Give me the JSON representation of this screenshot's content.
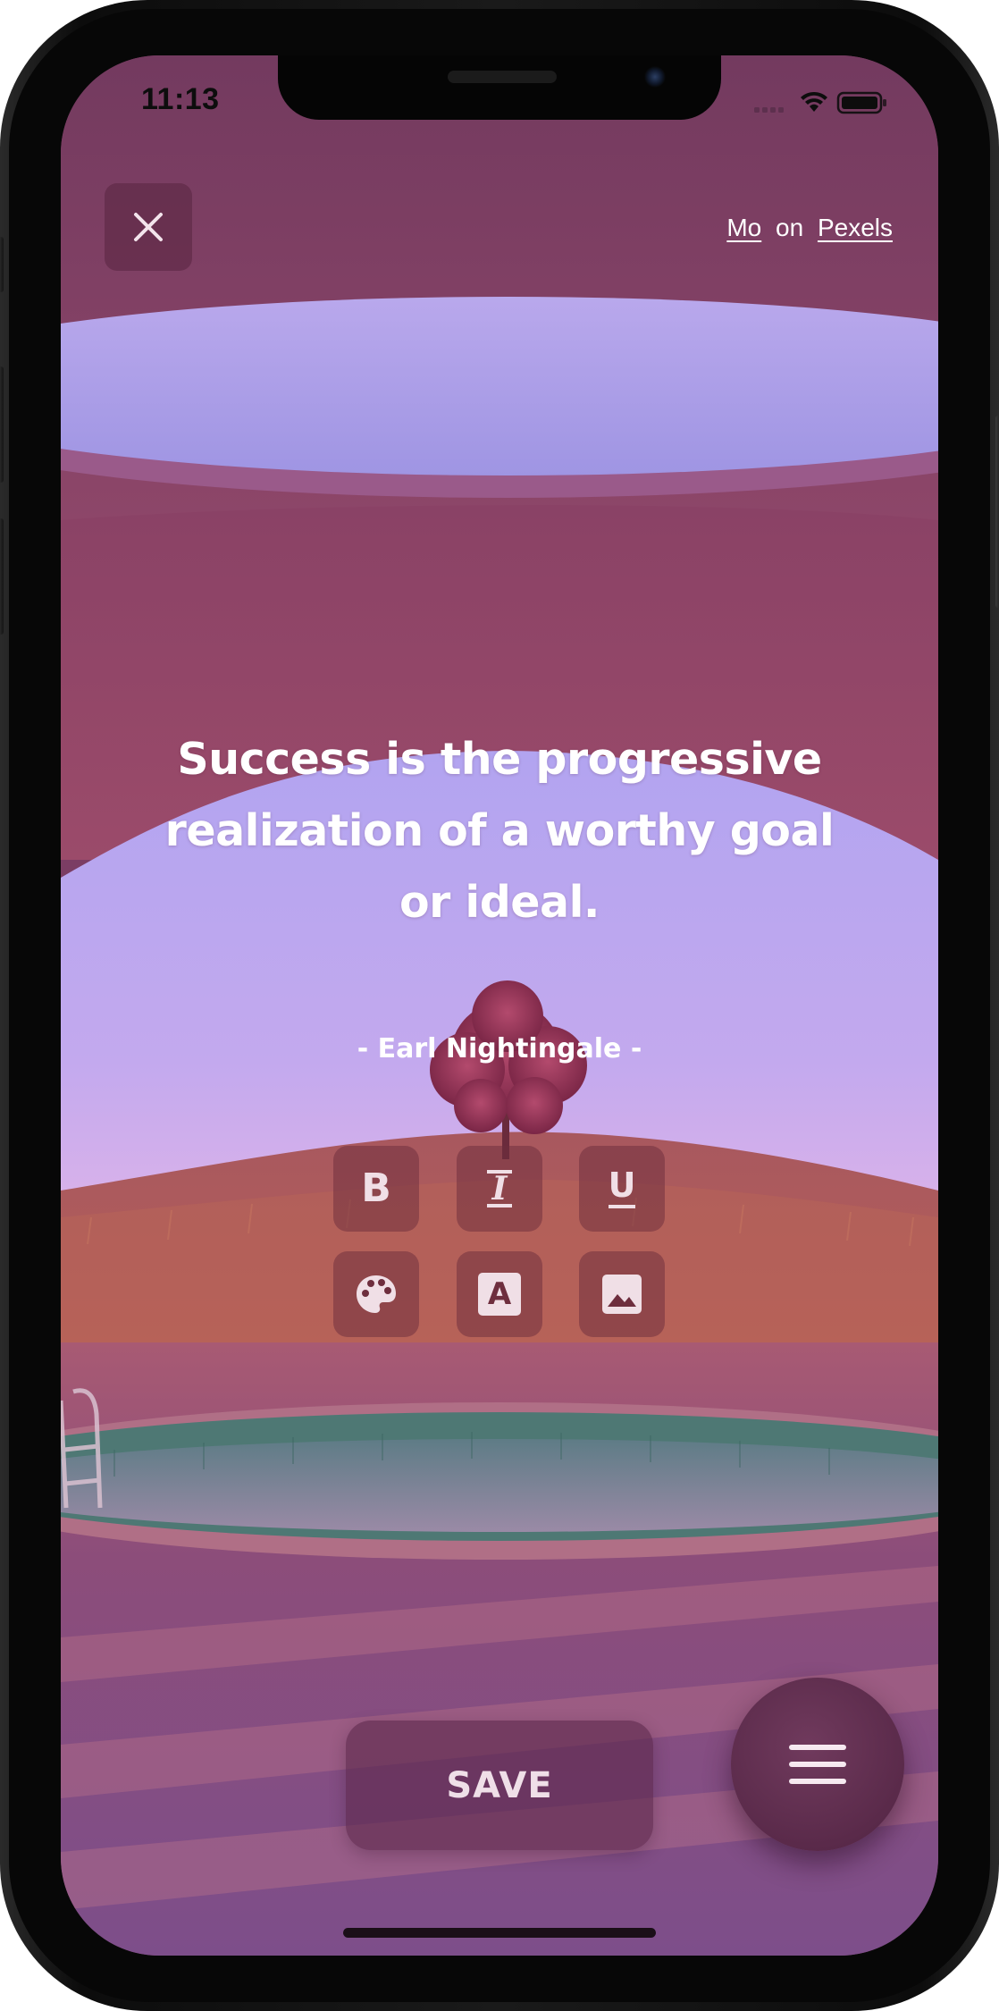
{
  "status_bar": {
    "time": "11:13"
  },
  "header": {
    "close_icon": "close-icon",
    "credit": {
      "author": "Mo",
      "separator": "on",
      "source": "Pexels"
    }
  },
  "quote": {
    "text": "Success is the progressive realization of a worthy goal or ideal.",
    "author": "- Earl Nightingale -"
  },
  "formatting": {
    "bold_label": "B",
    "italic_label": "I",
    "underline_label": "U",
    "font_label": "A",
    "icons": [
      "bold-icon",
      "italic-icon",
      "underline-icon",
      "palette-icon",
      "font-icon",
      "image-icon"
    ]
  },
  "actions": {
    "save_label": "SAVE",
    "menu_icon": "menu-icon"
  },
  "colors": {
    "accent": "#7b3d64",
    "sky": "#a99be6",
    "button_overlay": "#6e2e3e"
  }
}
